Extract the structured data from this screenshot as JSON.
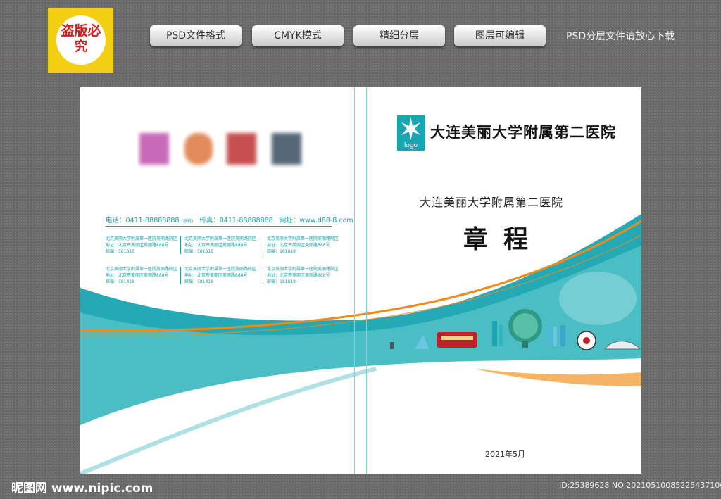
{
  "badge": {
    "text": "盗版必究"
  },
  "pills": [
    "PSD文件格式",
    "CMYK模式",
    "精细分层",
    "图层可编辑"
  ],
  "top_note": "PSD分层文件请放心下载",
  "back_cover": {
    "contact": {
      "phone": "电话：0411-88888888",
      "phone_note": "(总机)",
      "fax": "传真：0411-88888888",
      "web": "网址：www.d88-8.com"
    },
    "addresses": [
      {
        "line1": "北京美丽大学附属第一医院美丽路院区",
        "line2": "地址：北京市美丽区美丽路888号",
        "line3": "邮编：181818"
      },
      {
        "line1": "北京美丽大学附属第一医院美丽路院区",
        "line2": "地址：北京市美丽区美丽路888号",
        "line3": "邮编：181818"
      },
      {
        "line1": "北京美丽大学附属第一医院美丽路院区",
        "line2": "地址：北京市美丽区美丽路888号",
        "line3": "邮编：181818"
      },
      {
        "line1": "北京美丽大学附属第一医院美丽路院区",
        "line2": "地址：北京市美丽区美丽路888号",
        "line3": "邮编：181818"
      },
      {
        "line1": "北京美丽大学附属第一医院美丽路院区",
        "line2": "地址：北京市美丽区美丽路888号",
        "line3": "邮编：181818"
      },
      {
        "line1": "北京美丽大学附属第一医院美丽路院区",
        "line2": "地址：北京市美丽区美丽路888号",
        "line3": "邮编：181818"
      }
    ]
  },
  "front_cover": {
    "logo_label": "logo",
    "hospital_calligraphy": "大连美丽大学附属第二医院",
    "hospital_name": "大连美丽大学附属第二医院",
    "doc_title": "章程",
    "date": "2021年5月"
  },
  "watermark": {
    "site": "昵图网 www.nipic.com",
    "id_text": "ID:25389628 NO:20210510085225437106"
  },
  "colors": {
    "teal": "#1aa5b2",
    "orange": "#f08a1a",
    "badge_yellow": "#f2cf10",
    "badge_red": "#d42020"
  }
}
